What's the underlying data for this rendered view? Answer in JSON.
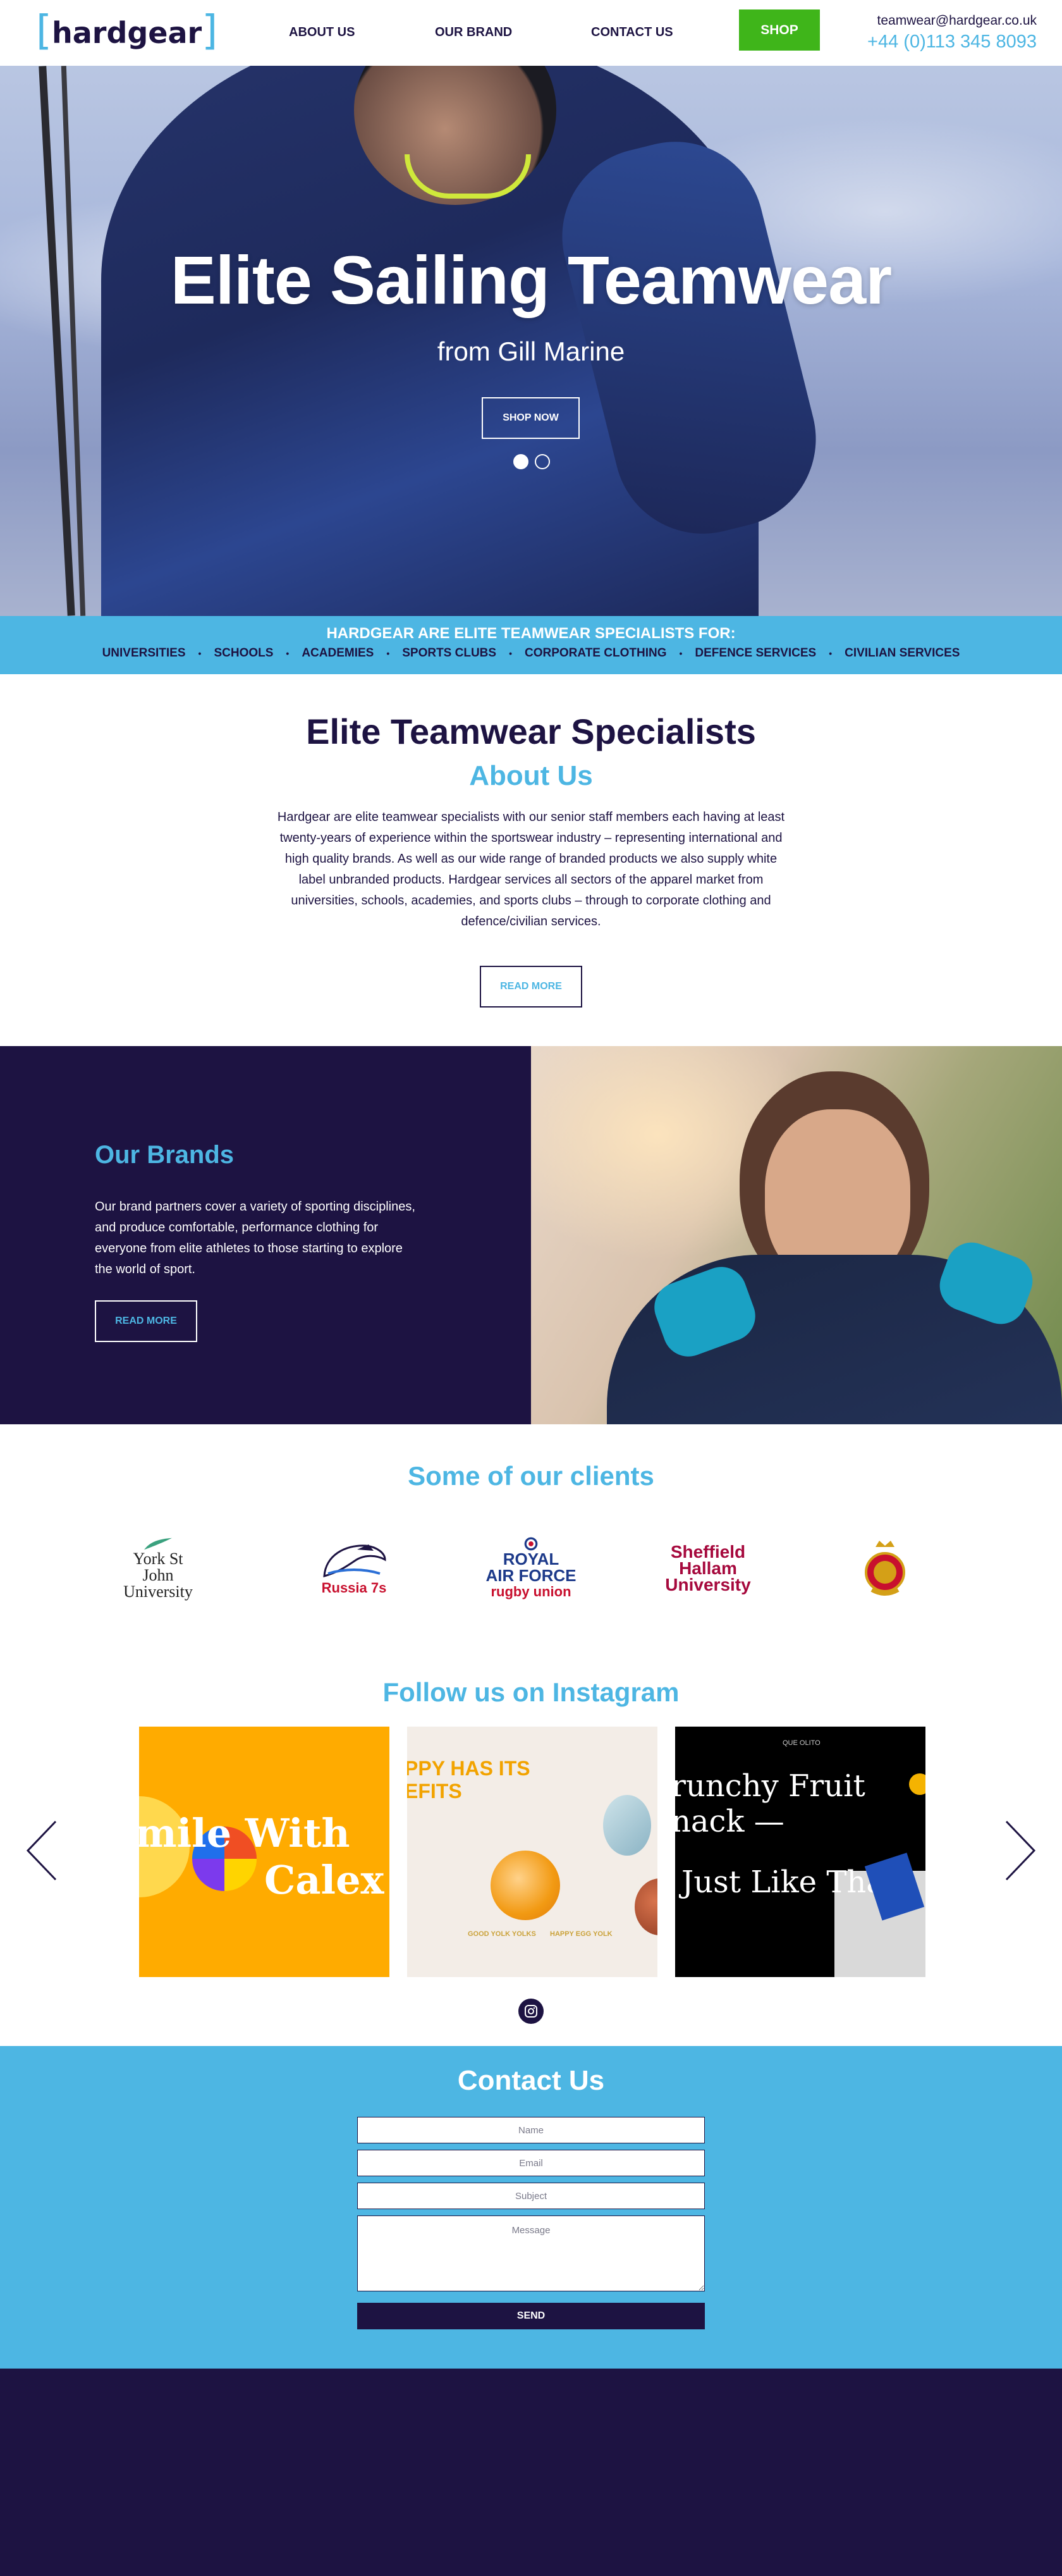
{
  "header": {
    "logo_text": "hardgear",
    "nav": [
      "ABOUT US",
      "OUR BRAND",
      "CONTACT US"
    ],
    "shop_label": "SHOP",
    "email": "teamwear@hardgear.co.uk",
    "phone": "+44 (0)113 345 8093"
  },
  "hero": {
    "title": "Elite Sailing Teamwear",
    "subtitle": "from Gill Marine",
    "button_label": "SHOP NOW",
    "slides": 2,
    "active_slide": 1
  },
  "band": {
    "title": "HARDGEAR ARE ELITE TEAMWEAR SPECIALISTS FOR:",
    "items": [
      "UNIVERSITIES",
      "SCHOOLS",
      "ACADEMIES",
      "SPORTS CLUBS",
      "CORPORATE CLOTHING",
      "DEFENCE SERVICES",
      "CIVILIAN SERVICES"
    ],
    "separator": "•"
  },
  "about": {
    "heading": "Elite Teamwear Specialists",
    "subheading": "About Us",
    "body": "Hardgear are elite teamwear specialists with our senior staff members each having at least twenty-years of experience within the sportswear industry – representing international and high quality brands. As well as our wide range of branded products we also supply white label unbranded products. Hardgear services all sectors of the apparel market from universities, schools, academies, and sports clubs – through to corporate clothing and defence/civilian services.",
    "button_label": "READ MORE"
  },
  "brands": {
    "heading": "Our Brands",
    "body": "Our brand partners cover a variety of sporting disciplines, and produce comfortable, performance clothing for everyone from elite athletes to those starting to explore the world of sport.",
    "button_label": "READ MORE"
  },
  "clients": {
    "heading": "Some of our clients",
    "york": [
      "York St John",
      "University"
    ],
    "russia": "Russia 7s",
    "raf": [
      "ROYAL",
      "AIR FORCE",
      "rugby union"
    ],
    "sheffield": [
      "Sheffield",
      "Hallam",
      "University"
    ],
    "crest": "ER"
  },
  "instagram": {
    "heading": "Follow us on Instagram",
    "post1_text": [
      "mile With",
      "Calex"
    ],
    "post2_text": [
      "PPY HAS ITS",
      "EFITS"
    ],
    "post2_labels": [
      "GOOD YOLK YOLKS",
      "HAPPY EGG YOLK"
    ],
    "post3_header": "QUE OLITO",
    "post3_text": [
      "runchy Fruit",
      "nack —"
    ],
    "post3_text2": "Just Like That"
  },
  "contact": {
    "heading": "Contact Us",
    "name_placeholder": "Name",
    "email_placeholder": "Email",
    "subject_placeholder": "Subject",
    "message_placeholder": "Message",
    "send_label": "SEND"
  },
  "colors": {
    "navy": "#1d1342",
    "accent_blue": "#4db6e3",
    "shop_green": "#3fb51a"
  }
}
